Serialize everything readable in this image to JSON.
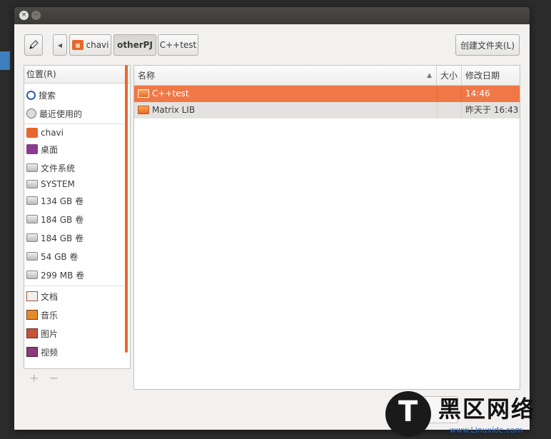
{
  "window": {
    "close_glyph": "×",
    "min_glyph": "−"
  },
  "toolbar": {
    "edit_icon": "pencil-icon",
    "back_glyph": "◀",
    "breadcrumbs": [
      "chavi",
      "otherPJ",
      "C++test"
    ],
    "active_crumb": "otherPJ",
    "create_folder_label": "创建文件夹(L)"
  },
  "places": {
    "header": "位置(R)",
    "items": [
      {
        "label": "搜索",
        "icon": "search-icon"
      },
      {
        "label": "最近使用的",
        "icon": "recent-icon"
      },
      {
        "label": "chavi",
        "icon": "home-folder-icon"
      },
      {
        "label": "桌面",
        "icon": "desktop-icon"
      },
      {
        "label": "文件系统",
        "icon": "drive-icon"
      },
      {
        "label": "SYSTEM",
        "icon": "drive-icon"
      },
      {
        "label": "134 GB 卷",
        "icon": "drive-icon"
      },
      {
        "label": "184 GB 卷",
        "icon": "drive-icon"
      },
      {
        "label": "184 GB 卷",
        "icon": "drive-icon"
      },
      {
        "label": "54 GB 卷",
        "icon": "drive-icon"
      },
      {
        "label": "299 MB 卷",
        "icon": "drive-icon"
      },
      {
        "label": "文档",
        "icon": "documents-icon"
      },
      {
        "label": "音乐",
        "icon": "music-icon"
      },
      {
        "label": "图片",
        "icon": "pictures-icon"
      },
      {
        "label": "视频",
        "icon": "videos-icon"
      }
    ],
    "add_glyph": "+",
    "remove_glyph": "−"
  },
  "files": {
    "columns": {
      "name": "名称",
      "size": "大小",
      "modified": "修改日期"
    },
    "sort_glyph": "▲",
    "rows": [
      {
        "name": "C++test",
        "size": "",
        "modified": "14:46",
        "selected": true
      },
      {
        "name": "Matrix LIB",
        "size": "",
        "modified": "昨天于 16:43",
        "selected": false
      }
    ]
  },
  "watermark": {
    "logo_letter": "T",
    "title": "黑区网络",
    "url": "www.Linuxidc.com"
  },
  "colors": {
    "accent": "#f07746",
    "titlebar": "#3b3a36",
    "dialog_bg": "#f2f1f0"
  }
}
